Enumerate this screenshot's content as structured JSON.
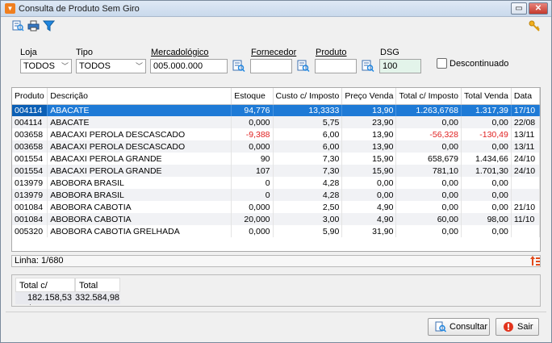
{
  "window": {
    "title": "Consulta de Produto Sem Giro",
    "minimize_glyph": "▭",
    "close_glyph": "✕"
  },
  "toolbar": {
    "icons": [
      "report-search-icon",
      "print-icon",
      "filter-icon"
    ],
    "right_icon": "key-icon"
  },
  "filters": {
    "loja": {
      "label": "Loja",
      "value": "TODOS"
    },
    "tipo": {
      "label": "Tipo",
      "value": "TODOS"
    },
    "mercadologico": {
      "label": "Mercadológico",
      "value": "005.000.000"
    },
    "fornecedor": {
      "label": "Fornecedor",
      "value": ""
    },
    "produto": {
      "label": "Produto",
      "value": ""
    },
    "dsg": {
      "label": "DSG",
      "value": "100"
    },
    "descontinuado": {
      "label": "Descontinuado",
      "checked": false
    }
  },
  "grid": {
    "columns": [
      "Produto",
      "Descrição",
      "Estoque",
      "Custo c/ Imposto",
      "Preço Venda",
      "Total c/ Imposto",
      "Total Venda",
      "Data"
    ],
    "rows": [
      [
        "004114",
        "ABACATE",
        "94,776",
        "13,3333",
        "13,90",
        "1.263,6768",
        "1.317,39",
        "17/10"
      ],
      [
        "004114",
        "ABACATE",
        "0,000",
        "5,75",
        "23,90",
        "0,00",
        "0,00",
        "22/08"
      ],
      [
        "003658",
        "ABACAXI PEROLA DESCASCADO",
        "-9,388",
        "6,00",
        "13,90",
        "-56,328",
        "-130,49",
        "13/11"
      ],
      [
        "003658",
        "ABACAXI PEROLA DESCASCADO",
        "0,000",
        "6,00",
        "13,90",
        "0,00",
        "0,00",
        "13/11"
      ],
      [
        "001554",
        "ABACAXI PEROLA GRANDE",
        "90",
        "7,30",
        "15,90",
        "658,679",
        "1.434,66",
        "24/10"
      ],
      [
        "001554",
        "ABACAXI PEROLA GRANDE",
        "107",
        "7,30",
        "15,90",
        "781,10",
        "1.701,30",
        "24/10"
      ],
      [
        "013979",
        "ABOBORA BRASIL",
        "0",
        "4,28",
        "0,00",
        "0,00",
        "0,00",
        ""
      ],
      [
        "013979",
        "ABOBORA BRASIL",
        "0",
        "4,28",
        "0,00",
        "0,00",
        "0,00",
        ""
      ],
      [
        "001084",
        "ABOBORA CABOTIA",
        "0,000",
        "2,50",
        "4,90",
        "0,00",
        "0,00",
        "21/10"
      ],
      [
        "001084",
        "ABOBORA CABOTIA",
        "20,000",
        "3,00",
        "4,90",
        "60,00",
        "98,00",
        "11/10"
      ],
      [
        "005320",
        "ABOBORA CABOTIA GRELHADA",
        "0,000",
        "5,90",
        "31,90",
        "0,00",
        "0,00",
        ""
      ]
    ],
    "negative_cells": [
      [
        2,
        2
      ],
      [
        2,
        5
      ],
      [
        2,
        6
      ]
    ]
  },
  "status": {
    "line": "Linha: 1/680"
  },
  "totals": {
    "headers": [
      "Total c/ Imposto",
      "Total Venda"
    ],
    "values": [
      "182.158,53",
      "332.584,98"
    ]
  },
  "buttons": {
    "consultar": "Consultar",
    "sair": "Sair"
  }
}
